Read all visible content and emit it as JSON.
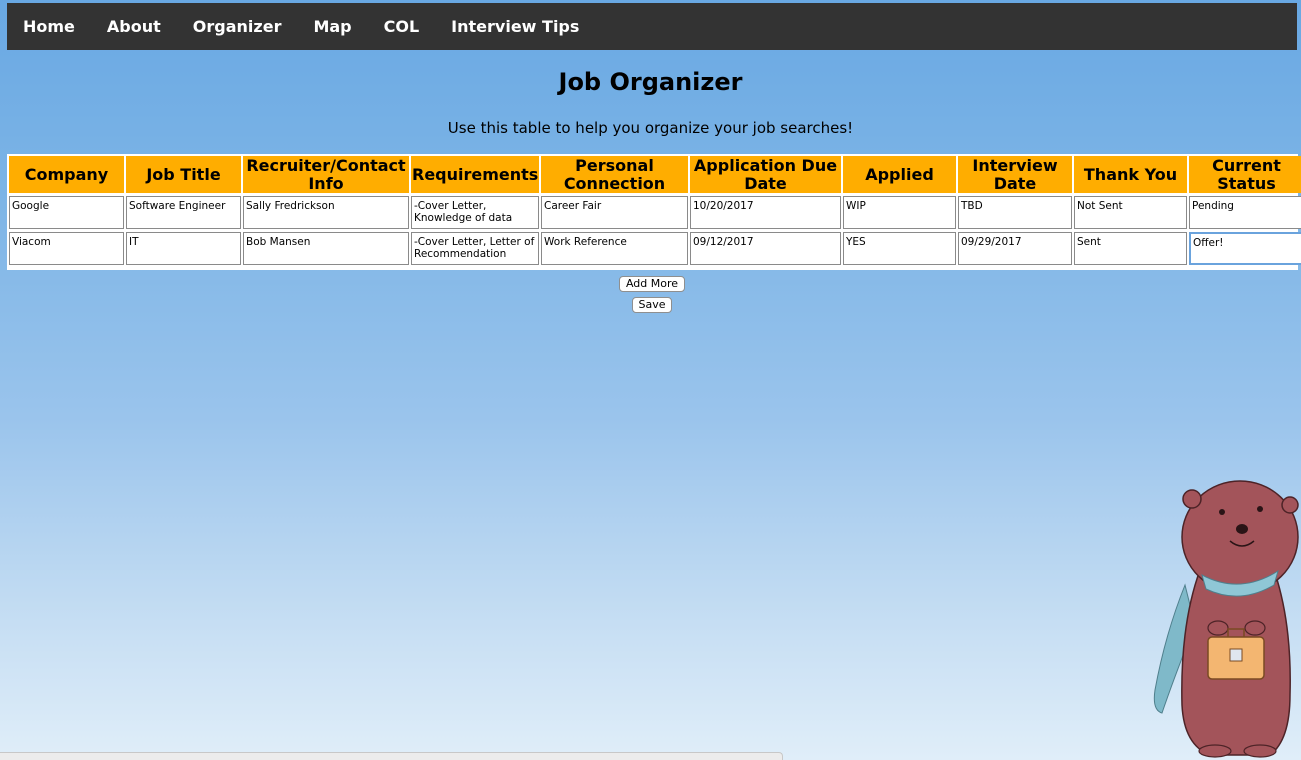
{
  "nav": {
    "items": [
      "Home",
      "About",
      "Organizer",
      "Map",
      "COL",
      "Interview Tips"
    ]
  },
  "page": {
    "title": "Job Organizer",
    "subtitle": "Use this table to help you organize your job searches!"
  },
  "table": {
    "headers": [
      "Company",
      "Job Title",
      "Recruiter/Contact Info",
      "Requirements",
      "Personal Connection",
      "Application Due Date",
      "Applied",
      "Interview Date",
      "Thank You",
      "Current Status"
    ],
    "rows": [
      [
        "Google",
        "Software Engineer",
        "Sally Fredrickson",
        "-Cover Letter, Knowledge of data",
        "Career Fair",
        "10/20/2017",
        "WIP",
        "TBD",
        "Not Sent",
        "Pending"
      ],
      [
        "Viacom",
        "IT",
        "Bob Mansen",
        "-Cover Letter, Letter of Recommendation",
        "Work Reference",
        "09/12/2017",
        "YES",
        "09/29/2017",
        "Sent",
        "Offer!"
      ]
    ]
  },
  "buttons": {
    "add_more": "Add More",
    "save": "Save"
  },
  "colors": {
    "navbar": "#333333",
    "header_cell": "#ffad00",
    "background_top": "#69a8e3",
    "background_bottom": "#e0eef9"
  },
  "mascot": {
    "icon": "otter-with-briefcase-illustration"
  }
}
